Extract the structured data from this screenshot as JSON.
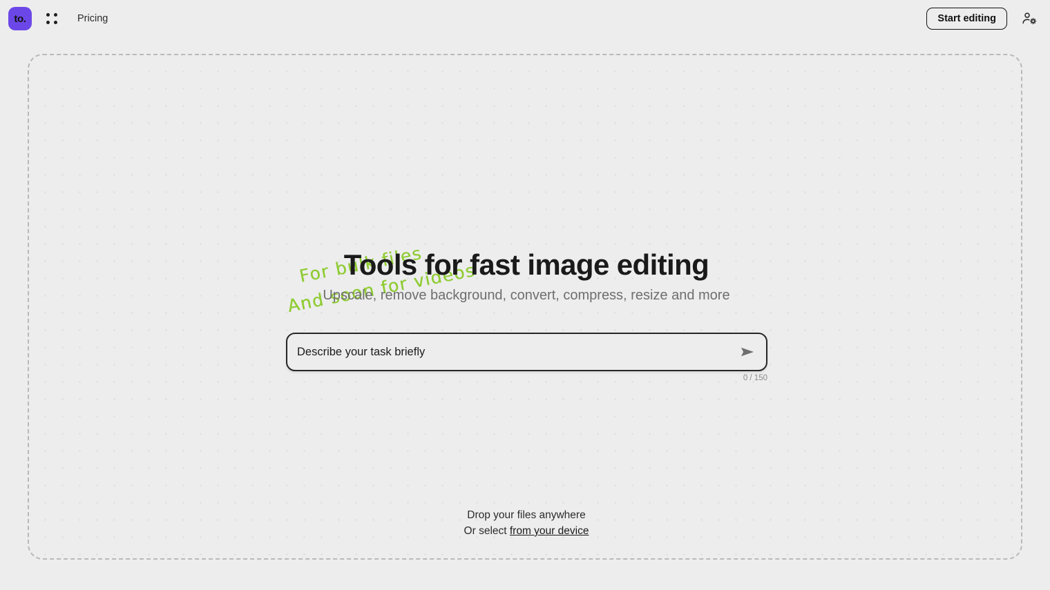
{
  "header": {
    "logo_text": "to.",
    "logo_color": "#6c47e8",
    "apps_icon": "grid-dots-icon",
    "nav": {
      "pricing": "Pricing"
    },
    "start_button": "Start editing",
    "account_icon": "user-settings-icon"
  },
  "hero": {
    "scribble_line1": "For bulk files",
    "scribble_line2": "And soon for videos",
    "scribble_color": "#8fcc33",
    "title": "Tools for fast image editing",
    "subtitle": "Upscale, remove background, convert, compress, resize and more"
  },
  "prompt": {
    "placeholder": "Describe your task briefly",
    "value": "",
    "send_icon": "send-arrow-icon",
    "counter": "0 / 150",
    "max_chars": 150
  },
  "dropzone": {
    "drop_line": "Drop your files anywhere",
    "select_prefix": "Or select ",
    "select_link": "from your device"
  }
}
